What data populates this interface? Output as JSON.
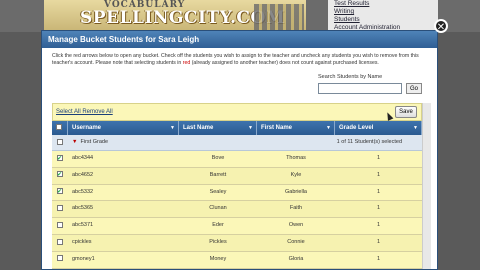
{
  "site": {
    "banner_top": "VOCABULARY",
    "logo": "SPELLINGCITY.COM",
    "top_links": [
      "Test Results",
      "Writing",
      "Students",
      "Account Administration"
    ]
  },
  "modal": {
    "title": "Manage Bucket Students for Sara Leigh",
    "instructions_before": "Click the red arrows below to open any bucket. Check off the students you wish to assign to the teacher and uncheck any students you wish to remove from this teacher's account. Please note that selecting students in ",
    "instructions_red": "red",
    "instructions_after": " (already assigned to another teacher) does not count against purchased licenses.",
    "search_label": "Search Students by Name",
    "search_value": "",
    "go_label": "Go",
    "select_all_remove_all": "Select All  Remove All",
    "save_label": "Save",
    "columns": [
      "Username",
      "Last Name",
      "First Name",
      "Grade Level"
    ],
    "group": {
      "name": "First Grade",
      "summary": "1 of 11 Student(s) selected"
    },
    "rows": [
      {
        "checked": true,
        "username": "abc4344",
        "last": "Bove",
        "first": "Thomas",
        "grade": "1"
      },
      {
        "checked": true,
        "username": "abc4652",
        "last": "Barrett",
        "first": "Kyle",
        "grade": "1"
      },
      {
        "checked": true,
        "username": "abc5332",
        "last": "Sealey",
        "first": "Gabriella",
        "grade": "1"
      },
      {
        "checked": false,
        "username": "abc5365",
        "last": "Clunan",
        "first": "Faith",
        "grade": "1"
      },
      {
        "checked": false,
        "username": "abc5371",
        "last": "Eder",
        "first": "Owen",
        "grade": "1"
      },
      {
        "checked": false,
        "username": "cpickles",
        "last": "Pickles",
        "first": "Connie",
        "grade": "1"
      },
      {
        "checked": false,
        "username": "gmoney1",
        "last": "Money",
        "first": "Gloria",
        "grade": "1"
      }
    ]
  }
}
